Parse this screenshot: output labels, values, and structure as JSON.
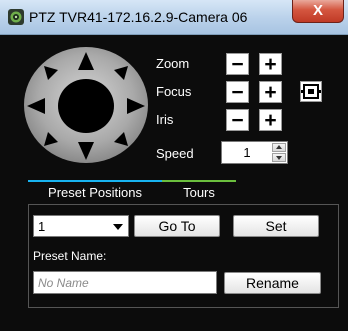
{
  "window": {
    "title": "PTZ  TVR41-172.16.2.9-Camera 06",
    "close_label": "X"
  },
  "controls": {
    "zoom_label": "Zoom",
    "focus_label": "Focus",
    "iris_label": "Iris",
    "speed_label": "Speed",
    "minus": "−",
    "plus": "+",
    "speed_value": "1"
  },
  "icons": {
    "app": "camera-icon",
    "autofocus": "autofocus-icon",
    "joystick": "pan-tilt-joystick"
  },
  "tabs": [
    {
      "label": "Preset Positions",
      "active": true
    },
    {
      "label": "Tours",
      "active": false
    }
  ],
  "preset": {
    "selected": "1",
    "goto_label": "Go To",
    "set_label": "Set",
    "name_label": "Preset Name:",
    "name_placeholder": "No Name",
    "rename_label": "Rename"
  },
  "colors": {
    "background": "#0c0c0c",
    "tab_active_accent": "#18b3f0",
    "tab_inactive_accent": "#6bbf3e"
  }
}
